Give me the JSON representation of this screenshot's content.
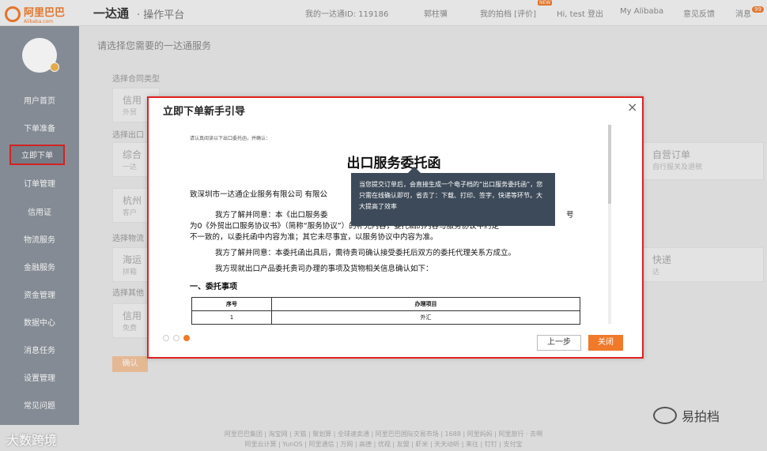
{
  "topbar": {
    "logo_text": "阿里巴巴",
    "logo_sub": "Alibaba.com",
    "app_title": "一达通",
    "app_sub": "· 操作平台",
    "account": "我的一达通ID: 119186",
    "links": [
      "郭柱骥",
      "我的拍档 [评价]",
      "Hi, test 登出",
      "My Alibaba",
      "意见反馈",
      "消息"
    ],
    "new_badge": "NEW",
    "msg_count": "99"
  },
  "sidebar": {
    "items": [
      "用户首页",
      "下单准备",
      "立即下单",
      "订单管理",
      "信用证",
      "物流服务",
      "金融服务",
      "资金管理",
      "数据中心",
      "消息任务",
      "设置管理",
      "常见问题"
    ]
  },
  "main": {
    "title": "请选择您需要的一达通服务",
    "labels": [
      "选择合同类型",
      "选择出口",
      "选择物流",
      "选择其他"
    ],
    "cards": [
      {
        "title": "信用",
        "sub": "外贸"
      },
      {
        "title": "综合",
        "sub": "一达"
      },
      {
        "title": "杭州",
        "sub": "客户"
      },
      {
        "title": "海运",
        "sub": "拼箱"
      },
      {
        "title": "信用",
        "sub": "免费"
      },
      {
        "title": "自营订单",
        "sub": "自行报关及退税"
      },
      {
        "title": "快递",
        "sub": "达"
      }
    ],
    "confirm": "确认"
  },
  "modal": {
    "title": "立即下单新手引导",
    "close_symbol": "×",
    "doc": {
      "note": "请认真阅读以下出口委托函，并确认：",
      "heading": "出口服务委托函",
      "addressee": "致深圳市一达通企业服务有限公司 有限公",
      "para1_a": "我方了解并同意：本《出口服务委",
      "para1_a_end": "号",
      "para1_b": "为0《外贸出口服务协议书》（简称“服务协议”）的补充内容，委托函的内容与服务协议中约定",
      "para1_c": "不一致的，以委托函中内容为准；其它未尽事宜，以服务协议中内容为准。",
      "para2": "我方了解并同意：本委托函出具后，需待贵司确认接受委托后双方的委托代理关系方成立。",
      "para3": "我方现就出口产品委托贵司办理的事项及货物相关信息确认如下：",
      "section": "一、委托事项",
      "table_headers": [
        "序号",
        "办理项目"
      ],
      "table_rows": [
        [
          "1",
          "外汇"
        ]
      ]
    },
    "tooltip": "当您提交订单后，会直接生成一个电子档的“出口服务委托函”，您只需在线确认即可，省去了：下载、打印、签字，快递等环节。大大提高了效率",
    "prev": "上一步",
    "close": "关闭"
  },
  "footer": {
    "line1": "阿里巴巴集团 | 淘宝网 | 天猫 | 聚划算 | 全球速卖通 | 阿里巴巴国际交易市场 | 1688 | 阿里妈妈 | 阿里旅行 · 去啊",
    "line2": "阿里云计算 | YunOS | 阿里通信 | 万网 | 高德 | 优视 | 友盟 | 虾米 | 天天动听 | 来往 | 钉钉 | 支付宝"
  },
  "watermarks": {
    "left": "大数跨境",
    "right": "易拍档"
  }
}
